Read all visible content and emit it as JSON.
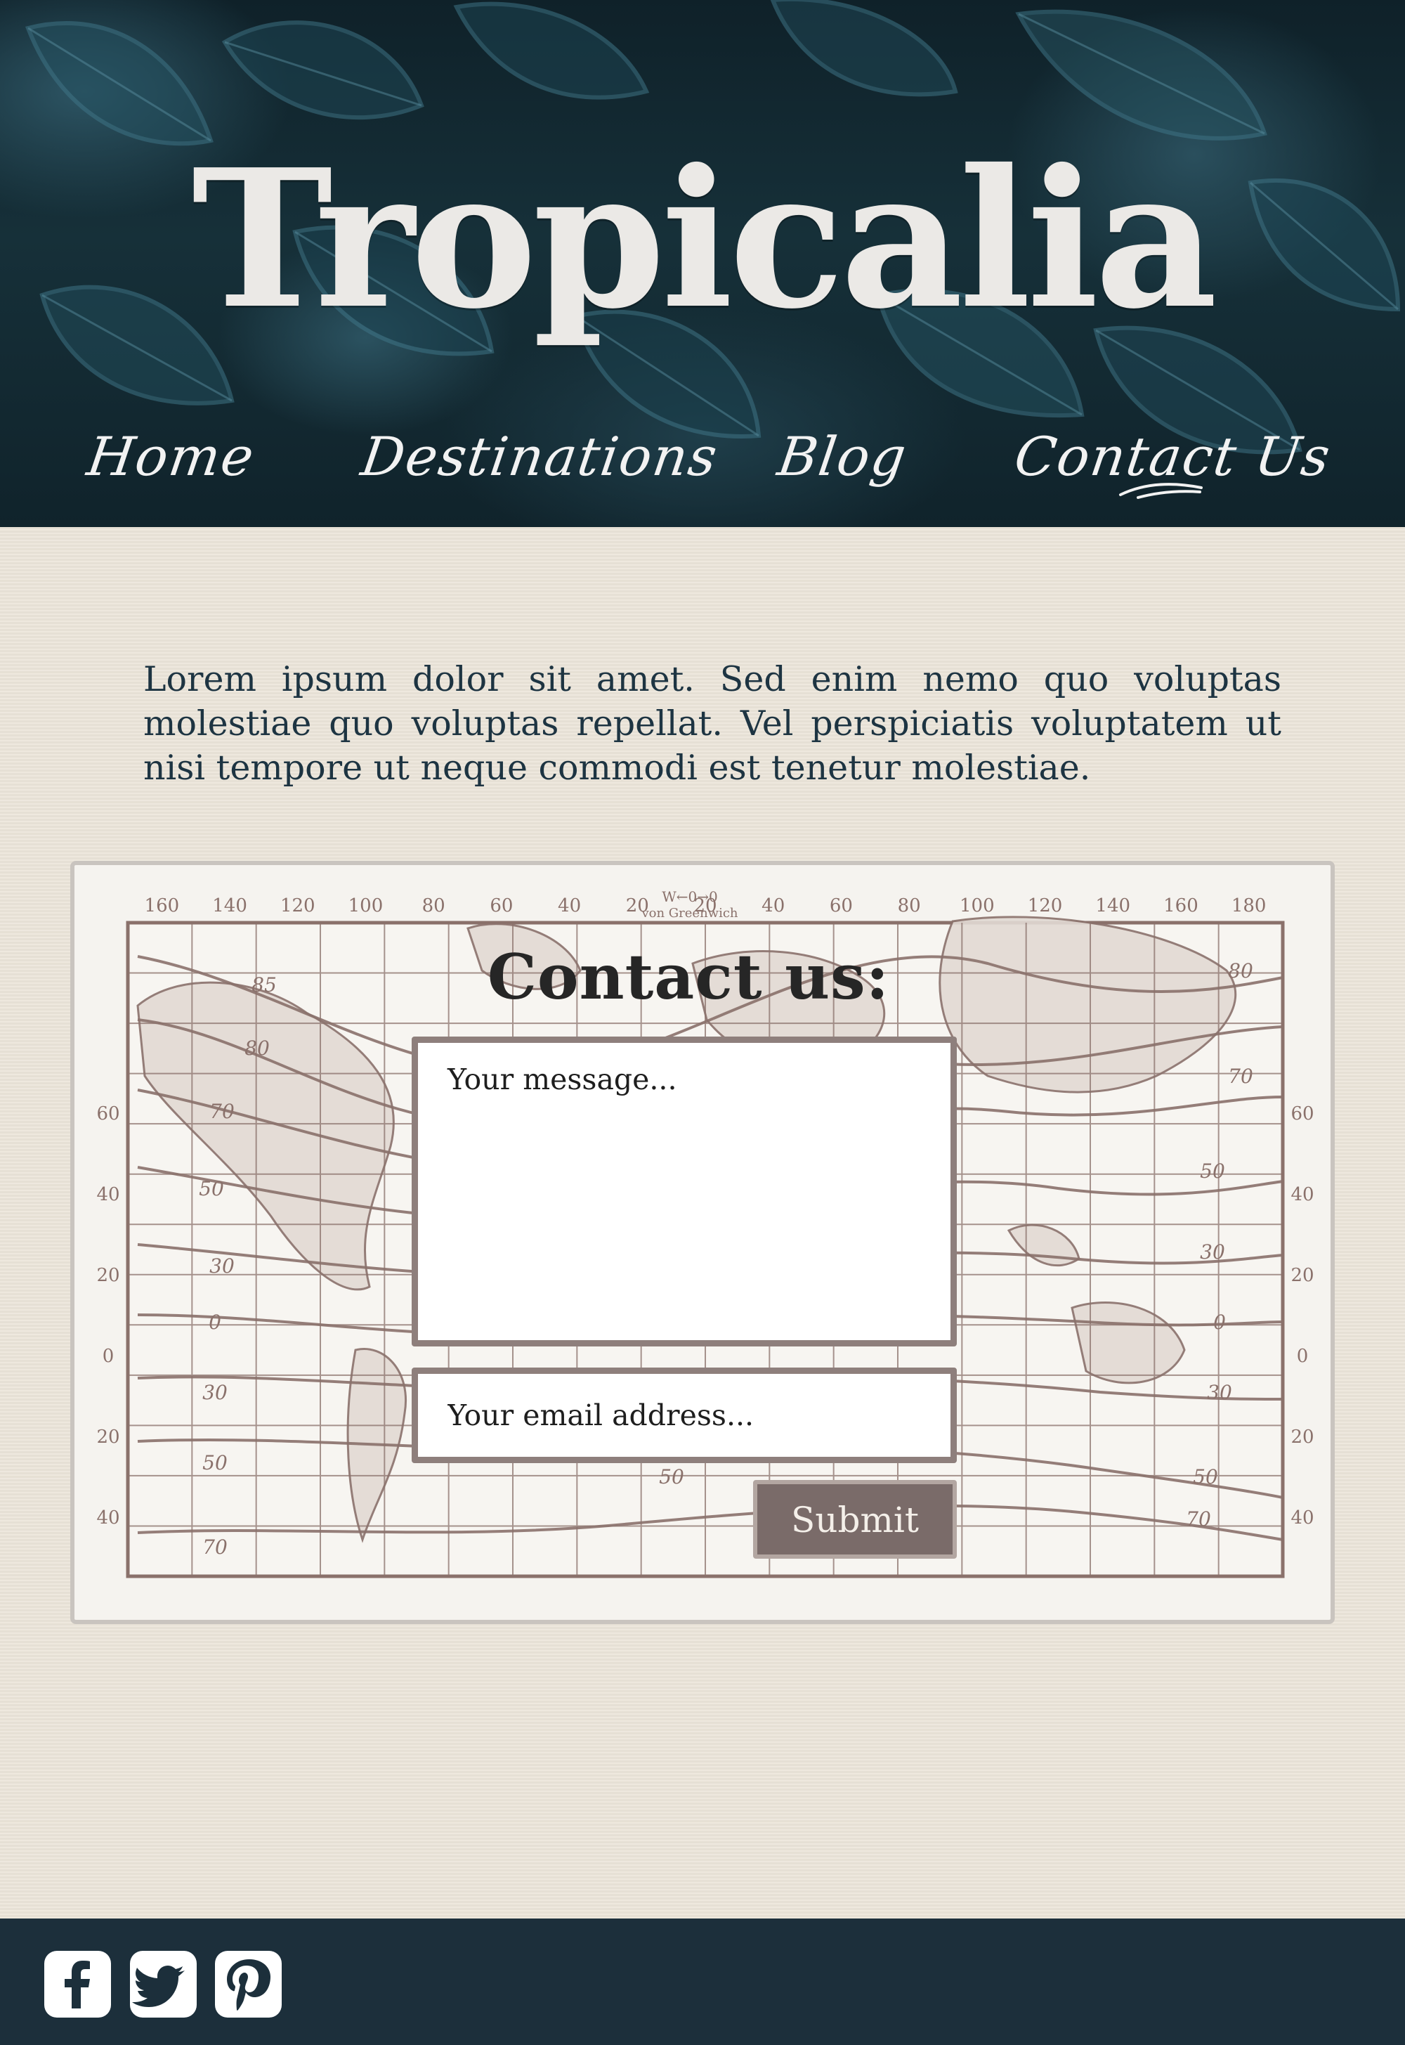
{
  "header": {
    "site_title": "Tropicalia",
    "nav": [
      {
        "label": "Home",
        "active": false
      },
      {
        "label": "Destinations",
        "active": false
      },
      {
        "label": "Blog",
        "active": false
      },
      {
        "label": "Contact Us",
        "active": true
      }
    ]
  },
  "main": {
    "intro_text": "Lorem ipsum dolor sit amet. Sed enim nemo quo voluptas molestiae quo voluptas repellat. Vel perspiciatis voluptatem ut nisi tempore ut neque commodi est tenetur molestiae."
  },
  "contact_form": {
    "title": "Contact us:",
    "message_placeholder": "Your message...",
    "email_placeholder": "Your email address...",
    "submit_label": "Submit"
  },
  "map": {
    "top_longitude_labels": [
      "160",
      "140",
      "120",
      "100",
      "80",
      "60",
      "40",
      "20",
      "20",
      "40",
      "60",
      "80",
      "100",
      "120",
      "140",
      "160",
      "180"
    ],
    "greenwich_label": "W←0→0",
    "greenwich_sub": "von Greenwich",
    "left_latitude_labels": [
      "60",
      "40",
      "20",
      "0",
      "20",
      "40"
    ],
    "right_latitude_labels": [
      "60",
      "40",
      "20",
      "0",
      "20",
      "40"
    ],
    "isotherm_labels": [
      "85",
      "80",
      "70",
      "50",
      "30",
      "0",
      "30",
      "50",
      "70",
      "80",
      "70",
      "50",
      "30",
      "0",
      "30",
      "50",
      "70",
      "50"
    ]
  },
  "footer": {
    "social": [
      {
        "icon": "facebook-icon"
      },
      {
        "icon": "twitter-icon"
      },
      {
        "icon": "pinterest-icon"
      }
    ]
  },
  "colors": {
    "header_bg": "#14303a",
    "paper_bg": "#ece5da",
    "footer_bg": "#1c2f3b",
    "map_ink": "#8a716b",
    "button_bg": "#7a6b69",
    "intro_text": "#1d3442"
  }
}
